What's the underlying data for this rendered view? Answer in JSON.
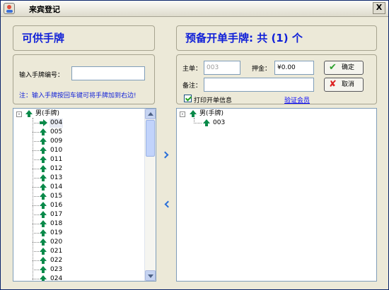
{
  "window": {
    "title": "来宾登记",
    "close_label": "X"
  },
  "left": {
    "heading": "可供手牌",
    "input_label": "输入手牌编号：",
    "input_value": "",
    "note": "注：输入手牌按回车键可将手牌加到右边!",
    "tree": {
      "root": "男(手牌)",
      "items": [
        "004",
        "005",
        "009",
        "010",
        "011",
        "012",
        "013",
        "014",
        "015",
        "016",
        "017",
        "018",
        "019",
        "020",
        "021",
        "022",
        "023",
        "024"
      ]
    }
  },
  "right": {
    "heading": "预备开单手牌: 共 (1) 个",
    "main_label": "主单：",
    "main_value": "003",
    "deposit_label": "押金：",
    "deposit_value": "¥0.00",
    "remark_label": "备注：",
    "remark_value": "",
    "print_label": "打印开单信息",
    "print_checked": true,
    "verify_link": "验证会员",
    "ok_label": "确定",
    "cancel_label": "取消",
    "tree": {
      "root": "男(手牌)",
      "items": [
        "003"
      ]
    }
  },
  "colors": {
    "heading_blue": "#0f1fd8",
    "icon_green": "#0a8a4a",
    "link_blue": "#0000ff"
  }
}
